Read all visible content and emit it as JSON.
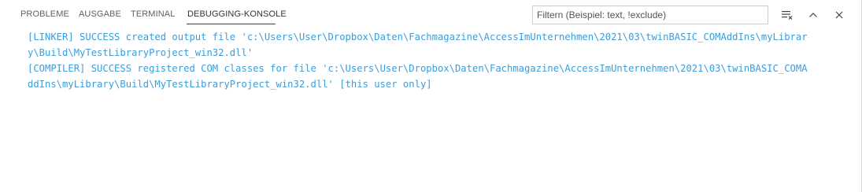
{
  "tabs": [
    {
      "label": "PROBLEME"
    },
    {
      "label": "AUSGABE"
    },
    {
      "label": "TERMINAL"
    },
    {
      "label": "DEBUGGING-KONSOLE"
    }
  ],
  "active_tab": "DEBUGGING-KONSOLE",
  "filter": {
    "placeholder": "Filtern (Beispiel: text, !exclude)",
    "value": ""
  },
  "icons": {
    "clear": "clear-console-icon",
    "collapse": "chevron-up-icon",
    "close": "close-icon"
  },
  "console": {
    "lines": [
      "[LINKER] SUCCESS created output file 'c:\\Users\\User\\Dropbox\\Daten\\Fachmagazine\\AccessImUnternehmen\\2021\\03\\twinBASIC_COMAddIns\\myLibrar",
      "y\\Build\\MyTestLibraryProject_win32.dll'",
      "[COMPILER] SUCCESS registered COM classes for file 'c:\\Users\\User\\Dropbox\\Daten\\Fachmagazine\\AccessImUnternehmen\\2021\\03\\twinBASIC_COMA",
      "ddIns\\myLibrary\\Build\\MyTestLibraryProject_win32.dll' [this user only]"
    ]
  },
  "colors": {
    "console_text": "#3c9dd9",
    "tab_text": "#616161",
    "active_underline": "#424242"
  }
}
